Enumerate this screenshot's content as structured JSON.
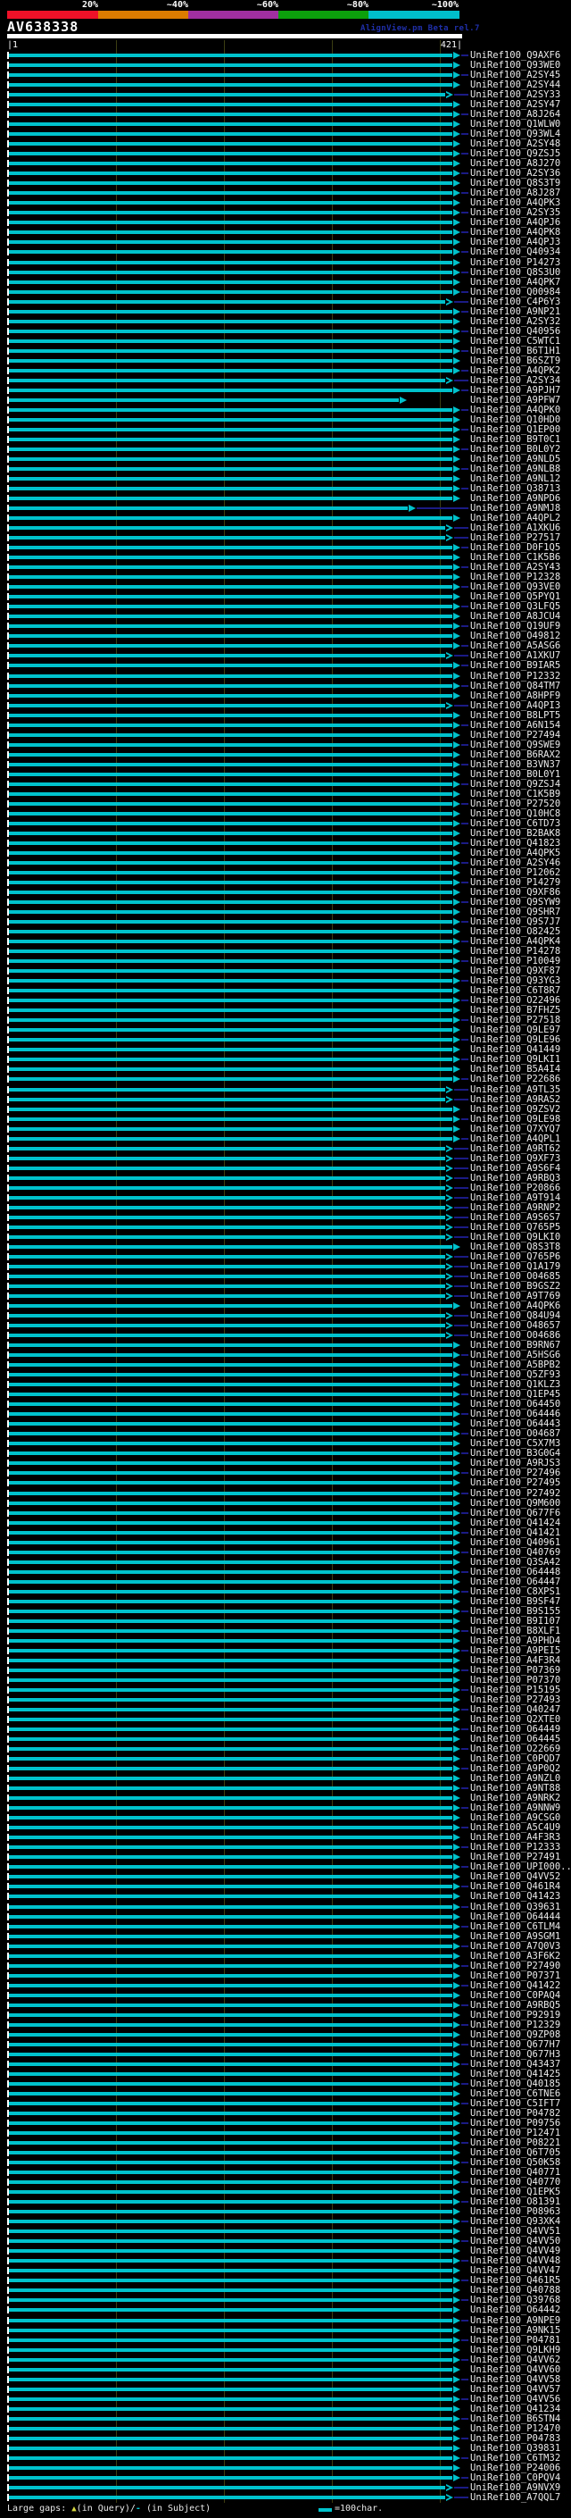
{
  "header": {
    "query_id": "AV638338",
    "watermark": "AlignView.pm Beta rel.7",
    "ruler_start_label": "|1",
    "ruler_end_label": "421|"
  },
  "legend": {
    "left_prefix": "Large gaps: ",
    "query_gap_symbol": "▲",
    "left_mid": "(in Query)/",
    "subject_gap_symbol": "-",
    "left_suffix": " (in Subject)",
    "scale_text": "=100char."
  },
  "colors": {
    "background": "#000000",
    "alignment_bar": "#00c2cc",
    "dim_connector": "#1b1b85",
    "gridline": "#3c3e12",
    "label_text": "#eaeaea",
    "watermark": "#1f2fa8",
    "gap_query_symbol": "#d6d640"
  },
  "chart_data": {
    "type": "alignment-map",
    "title": "AV638338",
    "query_length": 421,
    "ruler": {
      "start": 1,
      "end": 421,
      "gridline_interval_chars": 100
    },
    "identity_scale": [
      {
        "label": "20%",
        "color": "#ee1128"
      },
      {
        "label": "~40%",
        "color": "#dd7c00"
      },
      {
        "label": "~60%",
        "color": "#a12fa1"
      },
      {
        "label": "~80%",
        "color": "#0ca00c"
      },
      {
        "label": "~100%",
        "color": "#00bfcc"
      }
    ],
    "hits": [
      "UniRef100_Q9AXF6",
      "UniRef100_Q93WE0",
      "UniRef100_A2SY45",
      "UniRef100_A2SY44",
      "UniRef100_A2SY33",
      "UniRef100_A2SY47",
      "UniRef100_A8J264",
      "UniRef100_Q1WLW0",
      "UniRef100_Q93WL4",
      "UniRef100_A2SY48",
      "UniRef100_Q9ZSJ5",
      "UniRef100_A8J270",
      "UniRef100_A2SY36",
      "UniRef100_Q8S3T9",
      "UniRef100_A8J287",
      "UniRef100_A4QPK3",
      "UniRef100_A2SY35",
      "UniRef100_A4QPJ6",
      "UniRef100_A4QPK8",
      "UniRef100_A4QPJ3",
      "UniRef100_Q40934",
      "UniRef100_P14273",
      "UniRef100_Q8S3U0",
      "UniRef100_A4QPK7",
      "UniRef100_Q00984",
      "UniRef100_C4P6Y3",
      "UniRef100_A9NP21",
      "UniRef100_A2SY32",
      "UniRef100_Q40956",
      "UniRef100_C5WTC1",
      "UniRef100_B6T1H1",
      "UniRef100_B6SZT9",
      "UniRef100_A4QPK2",
      "UniRef100_A2SY34",
      "UniRef100_A9PJH7",
      "UniRef100_A9PFW7",
      "UniRef100_A4QPK0",
      "UniRef100_Q10HD0",
      "UniRef100_Q1EP00",
      "UniRef100_B9T0C1",
      "UniRef100_B0L0Y2",
      "UniRef100_A9NLD5",
      "UniRef100_A9NLB8",
      "UniRef100_A9NL12",
      "UniRef100_Q38713",
      "UniRef100_A9NPD6",
      "UniRef100_A9NMJ8",
      "UniRef100_A4QPL2",
      "UniRef100_A1XKU6",
      "UniRef100_P27517",
      "UniRef100_D0F1Q5",
      "UniRef100_C1K5B6",
      "UniRef100_A2SY43",
      "UniRef100_P12328",
      "UniRef100_Q93VE0",
      "UniRef100_Q5PYQ1",
      "UniRef100_Q3LFQ5",
      "UniRef100_A8JCU4",
      "UniRef100_Q19UF9",
      "UniRef100_O49812",
      "UniRef100_A5ASG6",
      "UniRef100_A1XKU7",
      "UniRef100_B9IAR5",
      "UniRef100_P12332",
      "UniRef100_Q84TM7",
      "UniRef100_A8HPF9",
      "UniRef100_A4QPI3",
      "UniRef100_B8LPT5",
      "UniRef100_A6N154",
      "UniRef100_P27494",
      "UniRef100_Q9SWE9",
      "UniRef100_B6RAX2",
      "UniRef100_B3VN37",
      "UniRef100_B0L0Y1",
      "UniRef100_Q9ZSJ4",
      "UniRef100_C1K5B9",
      "UniRef100_P27520",
      "UniRef100_Q10HC8",
      "UniRef100_C6TD73",
      "UniRef100_B2BAK8",
      "UniRef100_Q41823",
      "UniRef100_A4QPK5",
      "UniRef100_A2SY46",
      "UniRef100_P12062",
      "UniRef100_P14279",
      "UniRef100_Q9XF86",
      "UniRef100_Q9SYW9",
      "UniRef100_Q9SHR7",
      "UniRef100_Q9S7J7",
      "UniRef100_O82425",
      "UniRef100_A4QPK4",
      "UniRef100_P14278",
      "UniRef100_P10049",
      "UniRef100_Q9XF87",
      "UniRef100_Q93YG3",
      "UniRef100_C6T8R7",
      "UniRef100_O22496",
      "UniRef100_B7FHZ5",
      "UniRef100_P27518",
      "UniRef100_Q9LE97",
      "UniRef100_Q9LE96",
      "UniRef100_Q41449",
      "UniRef100_Q9LKI1",
      "UniRef100_B5A4I4",
      "UniRef100_P22686",
      "UniRef100_A9TL35",
      "UniRef100_A9RAS2",
      "UniRef100_Q9ZSV2",
      "UniRef100_Q9LE98",
      "UniRef100_Q7XYQ7",
      "UniRef100_A4QPL1",
      "UniRef100_A9RT62",
      "UniRef100_Q9XF73",
      "UniRef100_A9S6F4",
      "UniRef100_A9RBQ3",
      "UniRef100_P20866",
      "UniRef100_A9T914",
      "UniRef100_A9RNP2",
      "UniRef100_A9S6S7",
      "UniRef100_Q765P5",
      "UniRef100_Q9LKI0",
      "UniRef100_Q8S3T8",
      "UniRef100_Q765P6",
      "UniRef100_Q1A179",
      "UniRef100_O04685",
      "UniRef100_B9GSZ2",
      "UniRef100_A9T769",
      "UniRef100_A4QPK6",
      "UniRef100_Q84U94",
      "UniRef100_O48657",
      "UniRef100_O04686",
      "UniRef100_B9RN67",
      "UniRef100_A5HSG6",
      "UniRef100_A5BPB2",
      "UniRef100_Q5ZF93",
      "UniRef100_Q1KLZ3",
      "UniRef100_Q1EP45",
      "UniRef100_O64450",
      "UniRef100_O64446",
      "UniRef100_O64443",
      "UniRef100_O04687",
      "UniRef100_C5X7M3",
      "UniRef100_B3G0G4",
      "UniRef100_A9RJS3",
      "UniRef100_P27496",
      "UniRef100_P27495",
      "UniRef100_P27492",
      "UniRef100_Q9M600",
      "UniRef100_Q677F6",
      "UniRef100_Q41424",
      "UniRef100_Q41421",
      "UniRef100_Q40961",
      "UniRef100_Q40769",
      "UniRef100_Q3SA42",
      "UniRef100_O64448",
      "UniRef100_O64447",
      "UniRef100_C8XPS1",
      "UniRef100_B9SF47",
      "UniRef100_B9S155",
      "UniRef100_B9I107",
      "UniRef100_B8XLF1",
      "UniRef100_A9PHD4",
      "UniRef100_A9PEI5",
      "UniRef100_A4F3R4",
      "UniRef100_P07369",
      "UniRef100_P07370",
      "UniRef100_P15195",
      "UniRef100_P27493",
      "UniRef100_Q40247",
      "UniRef100_Q2XTE0",
      "UniRef100_O64449",
      "UniRef100_O64445",
      "UniRef100_O22669",
      "UniRef100_C0PQD7",
      "UniRef100_A9P0Q2",
      "UniRef100_A9NZL0",
      "UniRef100_A9NT88",
      "UniRef100_A9NRK2",
      "UniRef100_A9NNW9",
      "UniRef100_A9CSG0",
      "UniRef100_A5C4U9",
      "UniRef100_A4F3R3",
      "UniRef100_P12333",
      "UniRef100_P27491",
      "UniRef100_UPI000..",
      "UniRef100_Q4VV52",
      "UniRef100_Q461R4",
      "UniRef100_Q41423",
      "UniRef100_Q39631",
      "UniRef100_O64444",
      "UniRef100_C6TLM4",
      "UniRef100_A9SGM1",
      "UniRef100_A7Q0V3",
      "UniRef100_A3F6K2",
      "UniRef100_P27490",
      "UniRef100_P07371",
      "UniRef100_Q41422",
      "UniRef100_C0PAQ4",
      "UniRef100_A9RBQ5",
      "UniRef100_P92919",
      "UniRef100_P12329",
      "UniRef100_Q9ZP08",
      "UniRef100_Q677H7",
      "UniRef100_Q677H3",
      "UniRef100_Q43437",
      "UniRef100_Q41425",
      "UniRef100_Q40185",
      "UniRef100_C6TNE6",
      "UniRef100_C5IFT7",
      "UniRef100_P04782",
      "UniRef100_P09756",
      "UniRef100_P12471",
      "UniRef100_P08221",
      "UniRef100_Q6T705",
      "UniRef100_Q50K58",
      "UniRef100_Q40771",
      "UniRef100_Q40770",
      "UniRef100_Q1EPK5",
      "UniRef100_O81391",
      "UniRef100_P08963",
      "UniRef100_Q93XK4",
      "UniRef100_Q4VV51",
      "UniRef100_Q4VV50",
      "UniRef100_Q4VV49",
      "UniRef100_Q4VV48",
      "UniRef100_Q4VV47",
      "UniRef100_Q461R5",
      "UniRef100_Q40788",
      "UniRef100_Q39768",
      "UniRef100_O64442",
      "UniRef100_A9NPE9",
      "UniRef100_A9NK15",
      "UniRef100_P04781",
      "UniRef100_Q9LKH9",
      "UniRef100_Q4VV62",
      "UniRef100_Q4VV60",
      "UniRef100_Q4VV58",
      "UniRef100_Q4VV57",
      "UniRef100_Q4VV56",
      "UniRef100_Q41234",
      "UniRef100_B6STN4",
      "UniRef100_P12470",
      "UniRef100_P04783",
      "UniRef100_Q39831",
      "UniRef100_C6TM32",
      "UniRef100_P24006",
      "UniRef100_C0PQV4",
      "UniRef100_A9NVX9",
      "UniRef100_A7QQL7"
    ],
    "open_arrow_rows": [
      5,
      26,
      34,
      49,
      50,
      62,
      67,
      106,
      107,
      112,
      113,
      114,
      115,
      116,
      117,
      118,
      119,
      120,
      121,
      123,
      124,
      125,
      126,
      127,
      129,
      130,
      131,
      248,
      249
    ],
    "short_rows": {
      "36": 0.88,
      "47": 0.9
    }
  }
}
